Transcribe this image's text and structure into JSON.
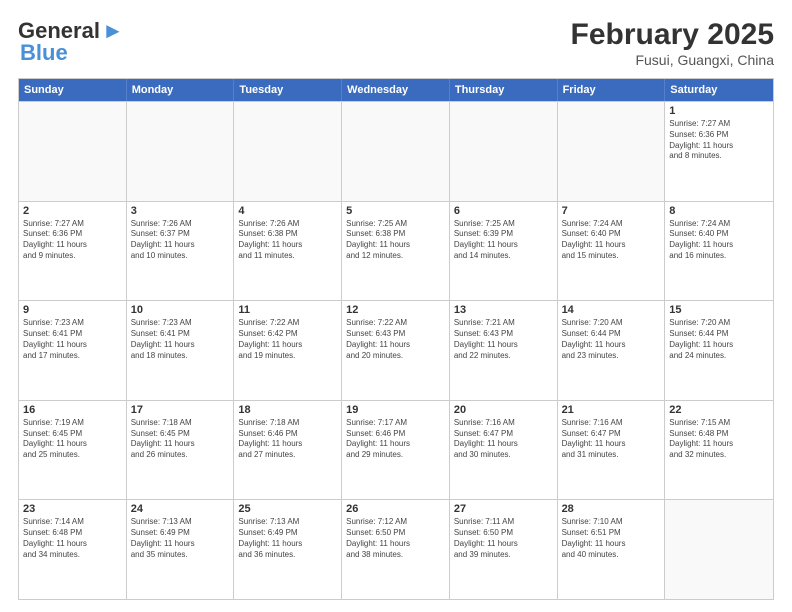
{
  "header": {
    "logo_line1": "General",
    "logo_line2": "Blue",
    "title": "February 2025",
    "subtitle": "Fusui, Guangxi, China"
  },
  "days_of_week": [
    "Sunday",
    "Monday",
    "Tuesday",
    "Wednesday",
    "Thursday",
    "Friday",
    "Saturday"
  ],
  "weeks": [
    [
      {
        "day": "",
        "info": ""
      },
      {
        "day": "",
        "info": ""
      },
      {
        "day": "",
        "info": ""
      },
      {
        "day": "",
        "info": ""
      },
      {
        "day": "",
        "info": ""
      },
      {
        "day": "",
        "info": ""
      },
      {
        "day": "1",
        "info": "Sunrise: 7:27 AM\nSunset: 6:36 PM\nDaylight: 11 hours\nand 8 minutes."
      }
    ],
    [
      {
        "day": "2",
        "info": "Sunrise: 7:27 AM\nSunset: 6:36 PM\nDaylight: 11 hours\nand 9 minutes."
      },
      {
        "day": "3",
        "info": "Sunrise: 7:26 AM\nSunset: 6:37 PM\nDaylight: 11 hours\nand 10 minutes."
      },
      {
        "day": "4",
        "info": "Sunrise: 7:26 AM\nSunset: 6:38 PM\nDaylight: 11 hours\nand 11 minutes."
      },
      {
        "day": "5",
        "info": "Sunrise: 7:25 AM\nSunset: 6:38 PM\nDaylight: 11 hours\nand 12 minutes."
      },
      {
        "day": "6",
        "info": "Sunrise: 7:25 AM\nSunset: 6:39 PM\nDaylight: 11 hours\nand 14 minutes."
      },
      {
        "day": "7",
        "info": "Sunrise: 7:24 AM\nSunset: 6:40 PM\nDaylight: 11 hours\nand 15 minutes."
      },
      {
        "day": "8",
        "info": "Sunrise: 7:24 AM\nSunset: 6:40 PM\nDaylight: 11 hours\nand 16 minutes."
      }
    ],
    [
      {
        "day": "9",
        "info": "Sunrise: 7:23 AM\nSunset: 6:41 PM\nDaylight: 11 hours\nand 17 minutes."
      },
      {
        "day": "10",
        "info": "Sunrise: 7:23 AM\nSunset: 6:41 PM\nDaylight: 11 hours\nand 18 minutes."
      },
      {
        "day": "11",
        "info": "Sunrise: 7:22 AM\nSunset: 6:42 PM\nDaylight: 11 hours\nand 19 minutes."
      },
      {
        "day": "12",
        "info": "Sunrise: 7:22 AM\nSunset: 6:43 PM\nDaylight: 11 hours\nand 20 minutes."
      },
      {
        "day": "13",
        "info": "Sunrise: 7:21 AM\nSunset: 6:43 PM\nDaylight: 11 hours\nand 22 minutes."
      },
      {
        "day": "14",
        "info": "Sunrise: 7:20 AM\nSunset: 6:44 PM\nDaylight: 11 hours\nand 23 minutes."
      },
      {
        "day": "15",
        "info": "Sunrise: 7:20 AM\nSunset: 6:44 PM\nDaylight: 11 hours\nand 24 minutes."
      }
    ],
    [
      {
        "day": "16",
        "info": "Sunrise: 7:19 AM\nSunset: 6:45 PM\nDaylight: 11 hours\nand 25 minutes."
      },
      {
        "day": "17",
        "info": "Sunrise: 7:18 AM\nSunset: 6:45 PM\nDaylight: 11 hours\nand 26 minutes."
      },
      {
        "day": "18",
        "info": "Sunrise: 7:18 AM\nSunset: 6:46 PM\nDaylight: 11 hours\nand 27 minutes."
      },
      {
        "day": "19",
        "info": "Sunrise: 7:17 AM\nSunset: 6:46 PM\nDaylight: 11 hours\nand 29 minutes."
      },
      {
        "day": "20",
        "info": "Sunrise: 7:16 AM\nSunset: 6:47 PM\nDaylight: 11 hours\nand 30 minutes."
      },
      {
        "day": "21",
        "info": "Sunrise: 7:16 AM\nSunset: 6:47 PM\nDaylight: 11 hours\nand 31 minutes."
      },
      {
        "day": "22",
        "info": "Sunrise: 7:15 AM\nSunset: 6:48 PM\nDaylight: 11 hours\nand 32 minutes."
      }
    ],
    [
      {
        "day": "23",
        "info": "Sunrise: 7:14 AM\nSunset: 6:48 PM\nDaylight: 11 hours\nand 34 minutes."
      },
      {
        "day": "24",
        "info": "Sunrise: 7:13 AM\nSunset: 6:49 PM\nDaylight: 11 hours\nand 35 minutes."
      },
      {
        "day": "25",
        "info": "Sunrise: 7:13 AM\nSunset: 6:49 PM\nDaylight: 11 hours\nand 36 minutes."
      },
      {
        "day": "26",
        "info": "Sunrise: 7:12 AM\nSunset: 6:50 PM\nDaylight: 11 hours\nand 38 minutes."
      },
      {
        "day": "27",
        "info": "Sunrise: 7:11 AM\nSunset: 6:50 PM\nDaylight: 11 hours\nand 39 minutes."
      },
      {
        "day": "28",
        "info": "Sunrise: 7:10 AM\nSunset: 6:51 PM\nDaylight: 11 hours\nand 40 minutes."
      },
      {
        "day": "",
        "info": ""
      }
    ]
  ]
}
